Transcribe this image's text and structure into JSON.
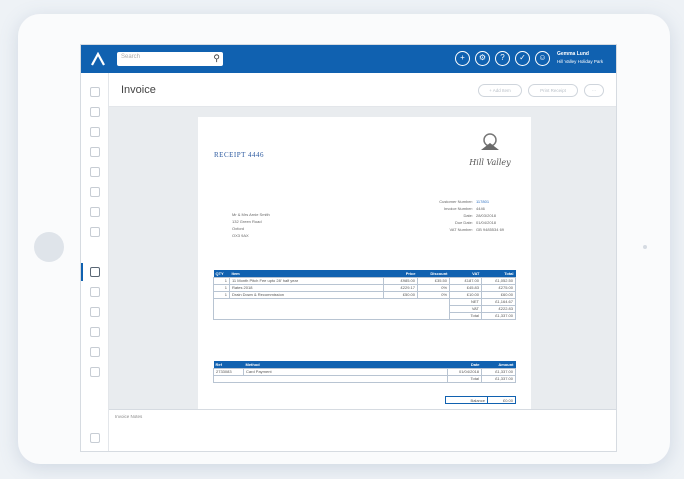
{
  "app": {
    "search_placeholder": "Search"
  },
  "user": {
    "name": "Gemma Lund",
    "company": "Hill Valley Holiday Park"
  },
  "page": {
    "title": "Invoice"
  },
  "header_buttons": {
    "add_item": "+ Add Item",
    "print": "Print Receipt",
    "more": "···"
  },
  "notes_label": "Invoice Notes",
  "receipt": {
    "title": "RECEIPT 4446",
    "brand": "Hill Valley",
    "address": [
      "Mr & Mrs Arnie Smith",
      "132 Green Road",
      "Oxford",
      "OX3 9AX"
    ],
    "meta": [
      {
        "label": "Customer Number:",
        "value": "117801"
      },
      {
        "label": "Invoice Number:",
        "value": "4446"
      },
      {
        "label": "Date:",
        "value": "28/03/2018"
      },
      {
        "label": "Due Date:",
        "value": "01/04/2018"
      },
      {
        "label": "VAT Number:",
        "value": "GB 9485534 69"
      }
    ],
    "items_header": [
      "QTY",
      "Item",
      "Price",
      "Discount",
      "VAT",
      "Total"
    ],
    "items": [
      [
        "1",
        "11 Month Pitch Fee upto 28' half year",
        "£985.00",
        "£35.50",
        "£187.00",
        "£1,052.50"
      ],
      [
        "1",
        "Rates 2018",
        "£229.17",
        "0%",
        "£45.83",
        "£275.00"
      ],
      [
        "1",
        "Drain Down & Recommission",
        "£50.00",
        "0%",
        "£10.00",
        "£60.00"
      ]
    ],
    "totals": [
      {
        "label": "NET",
        "value": "£1,164.67"
      },
      {
        "label": "VAT",
        "value": "£222.83"
      },
      {
        "label": "Total",
        "value": "£1,337.00"
      }
    ],
    "payments_header": [
      "Ref",
      "Method",
      "Date",
      "Amount"
    ],
    "payments": [
      [
        "2733083",
        "Card Payment",
        "01/04/2018",
        "£1,337.00"
      ]
    ],
    "payments_total": {
      "label": "Total",
      "value": "£1,337.00"
    },
    "balance": {
      "label": "Balance",
      "value": "£0.00"
    }
  }
}
